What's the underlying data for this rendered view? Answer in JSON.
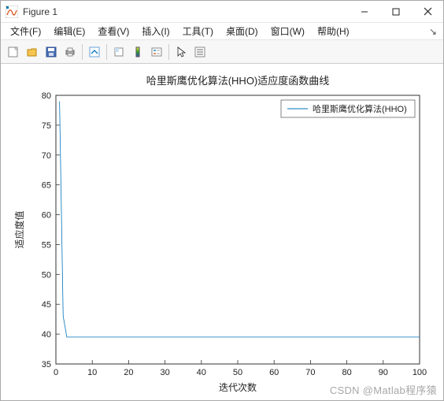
{
  "window": {
    "title": "Figure 1",
    "icon_name": "matlab-figure-icon"
  },
  "menubar": {
    "items": [
      {
        "label": "文件(F)"
      },
      {
        "label": "编辑(E)"
      },
      {
        "label": "查看(V)"
      },
      {
        "label": "插入(I)"
      },
      {
        "label": "工具(T)"
      },
      {
        "label": "桌面(D)"
      },
      {
        "label": "窗口(W)"
      },
      {
        "label": "帮助(H)"
      }
    ]
  },
  "toolbar": {
    "new_tip": "新建",
    "open_tip": "打开",
    "save_tip": "保存",
    "print_tip": "打印",
    "edit_tip": "编辑绘图",
    "link_tip": "链接",
    "insert_tip": "插入颜色栏",
    "legend_tip": "插入图例",
    "cursor_tip": "指针",
    "props_tip": "属性"
  },
  "chart_data": {
    "type": "line",
    "title": "哈里斯鹰优化算法(HHO)适应度函数曲线",
    "xlabel": "迭代次数",
    "ylabel": "适应度值",
    "xlim": [
      0,
      100
    ],
    "ylim": [
      35,
      80
    ],
    "x_ticks": [
      0,
      10,
      20,
      30,
      40,
      50,
      60,
      70,
      80,
      90,
      100
    ],
    "y_ticks": [
      35,
      40,
      45,
      50,
      55,
      60,
      65,
      70,
      75,
      80
    ],
    "series": [
      {
        "name": "哈里斯鹰优化算法(HHO)",
        "color": "#0072bd",
        "x": [
          1,
          2,
          3,
          4,
          5,
          10,
          20,
          30,
          40,
          50,
          60,
          70,
          80,
          90,
          100
        ],
        "y": [
          79.0,
          43.0,
          39.5,
          39.5,
          39.5,
          39.5,
          39.5,
          39.5,
          39.5,
          39.5,
          39.5,
          39.5,
          39.5,
          39.5,
          39.5
        ]
      }
    ],
    "legend_position": "upper-right"
  },
  "watermark": "CSDN @Matlab程序猿"
}
